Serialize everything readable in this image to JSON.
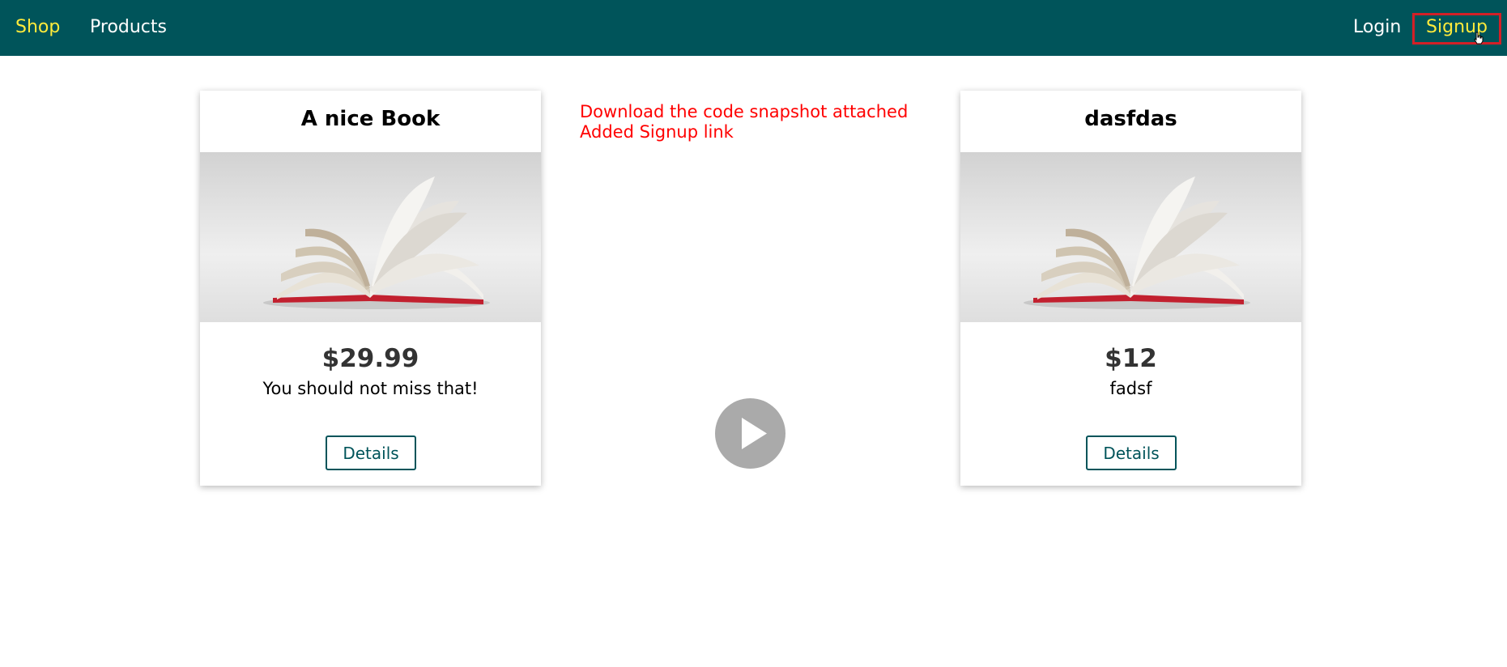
{
  "nav": {
    "shop": "Shop",
    "products": "Products",
    "login": "Login",
    "signup": "Signup"
  },
  "products": [
    {
      "title": "A nice Book",
      "image": "book-image",
      "price": "$29.99",
      "description": "You should not miss that!",
      "details_label": "Details"
    },
    {
      "title": "dasfdas",
      "image": "book-image",
      "price": "$12",
      "description": "fadsf",
      "details_label": "Details"
    }
  ],
  "overlay_note": {
    "line1": "Download the code snapshot attached",
    "line2": "Added Signup link"
  },
  "player": {
    "icon": "play-icon"
  },
  "colors": {
    "header_bg": "#00545a",
    "active_nav": "#ffeb3b",
    "nav_text": "#ffffff",
    "highlight_border": "#d32027",
    "note_text": "#ff0000",
    "price_text": "#333333",
    "play_button": "#aaaaaa"
  }
}
